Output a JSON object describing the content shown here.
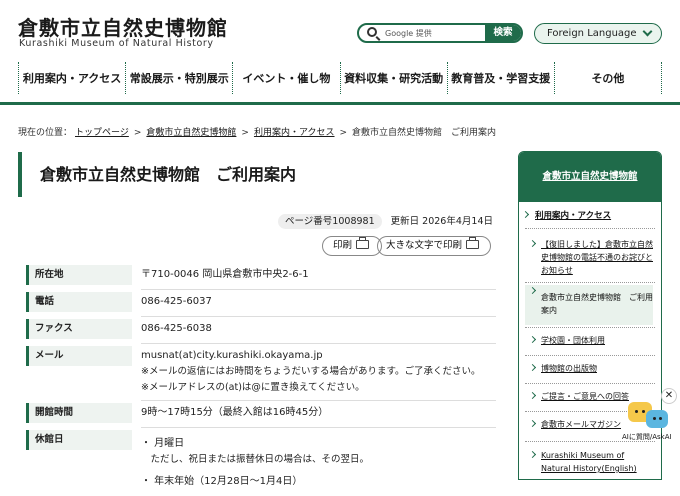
{
  "header": {
    "title_jp": "倉敷市立自然史博物館",
    "title_en": "Kurashiki Museum of Natural History",
    "search_placeholder": "Google 提供",
    "search_button": "検索",
    "language": "Foreign Language"
  },
  "nav": [
    "利用案内・アクセス",
    "常設展示・特別展示",
    "イベント・催し物",
    "資料収集・研究活動",
    "教育普及・学習支援",
    "その他"
  ],
  "breadcrumb": {
    "prefix": "現在の位置：",
    "links": [
      "トップページ",
      "倉敷市立自然史博物館",
      "利用案内・アクセス"
    ],
    "current": "倉敷市立自然史博物館　ご利用案内"
  },
  "page": {
    "title": "倉敷市立自然史博物館　ご利用案内",
    "page_no": "ページ番号1008981",
    "updated": "更新日  2026年4月14日",
    "print": "印刷",
    "print_large": "大きな文字で印刷"
  },
  "info": [
    {
      "label": "所在地",
      "lines": [
        "〒710-0046 岡山県倉敷市中央2-6-1"
      ]
    },
    {
      "label": "電話",
      "lines": [
        "086-425-6037"
      ]
    },
    {
      "label": "ファクス",
      "lines": [
        "086-425-6038"
      ]
    },
    {
      "label": "メール",
      "lines": [
        "musnat(at)city.kurashiki.okayama.jp",
        "※メールの返信にはお時間をちょうだいする場合があります。ご了承ください。",
        "※メールアドレスの(at)は@に置き換えてください。"
      ]
    },
    {
      "label": "開館時間",
      "lines": [
        "9時～17時15分（最終入館は16時45分）"
      ]
    },
    {
      "label": "休館日",
      "lines": [
        "・ 月曜日",
        "　ただし、祝日または振替休日の場合は、その翌日。",
        "・ 年末年始（12月28日～1月4日）"
      ]
    }
  ],
  "sidebar": {
    "title": "倉敷市立自然史博物館",
    "section": "利用案内・アクセス",
    "items": [
      "【復旧しました】倉敷市立自然史博物館の電話不通のお詫びとお知らせ",
      "倉敷市立自然史博物館　ご利用案内",
      "学校園・団体利用",
      "博物館の出版物",
      "ご提言・ご意見への回答",
      "倉敷市メールマガジン",
      "Kurashiki Museum of Natural History(English)"
    ]
  },
  "ask": {
    "label": "AIに質問/AskAI",
    "close": "✕"
  }
}
